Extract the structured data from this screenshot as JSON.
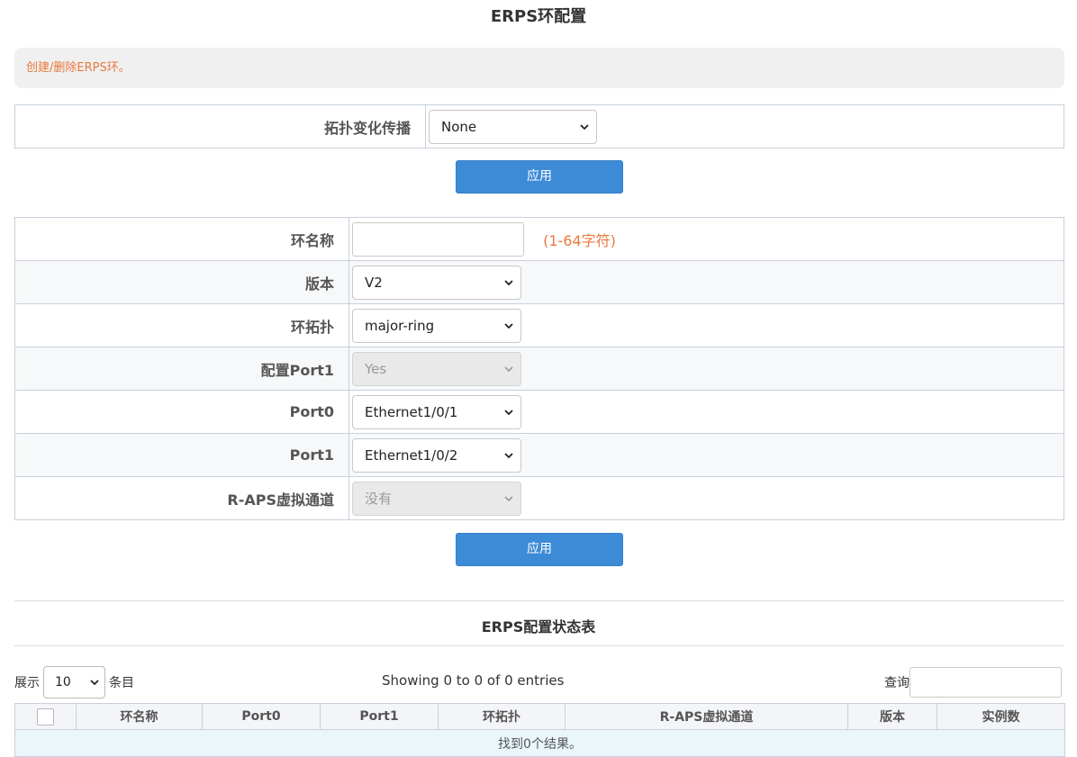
{
  "page_title": "ERPS环配置",
  "info_banner": "创建/删除ERPS环。",
  "topology_form": {
    "label": "拓扑变化传播",
    "value": "None"
  },
  "apply_label": "应用",
  "ring_form": {
    "ring_name": {
      "label": "环名称",
      "value": "",
      "hint": "(1-64字符)"
    },
    "version": {
      "label": "版本",
      "value": "V2"
    },
    "topology": {
      "label": "环拓扑",
      "value": "major-ring"
    },
    "config_port1": {
      "label": "配置Port1",
      "value": "Yes"
    },
    "port0": {
      "label": "Port0",
      "value": "Ethernet1/0/1"
    },
    "port1": {
      "label": "Port1",
      "value": "Ethernet1/0/2"
    },
    "raps_channel": {
      "label": "R-APS虚拟通道",
      "value": "没有"
    }
  },
  "status_table": {
    "title": "ERPS配置状态表",
    "length_prefix": "展示",
    "length_value": "10",
    "length_suffix": "条目",
    "info": "Showing 0 to 0 of 0 entries",
    "search_label": "查询",
    "columns": [
      "环名称",
      "Port0",
      "Port1",
      "环拓扑",
      "R-APS虚拟通道",
      "版本",
      "实例数"
    ],
    "empty_message": "找到0个结果。"
  }
}
